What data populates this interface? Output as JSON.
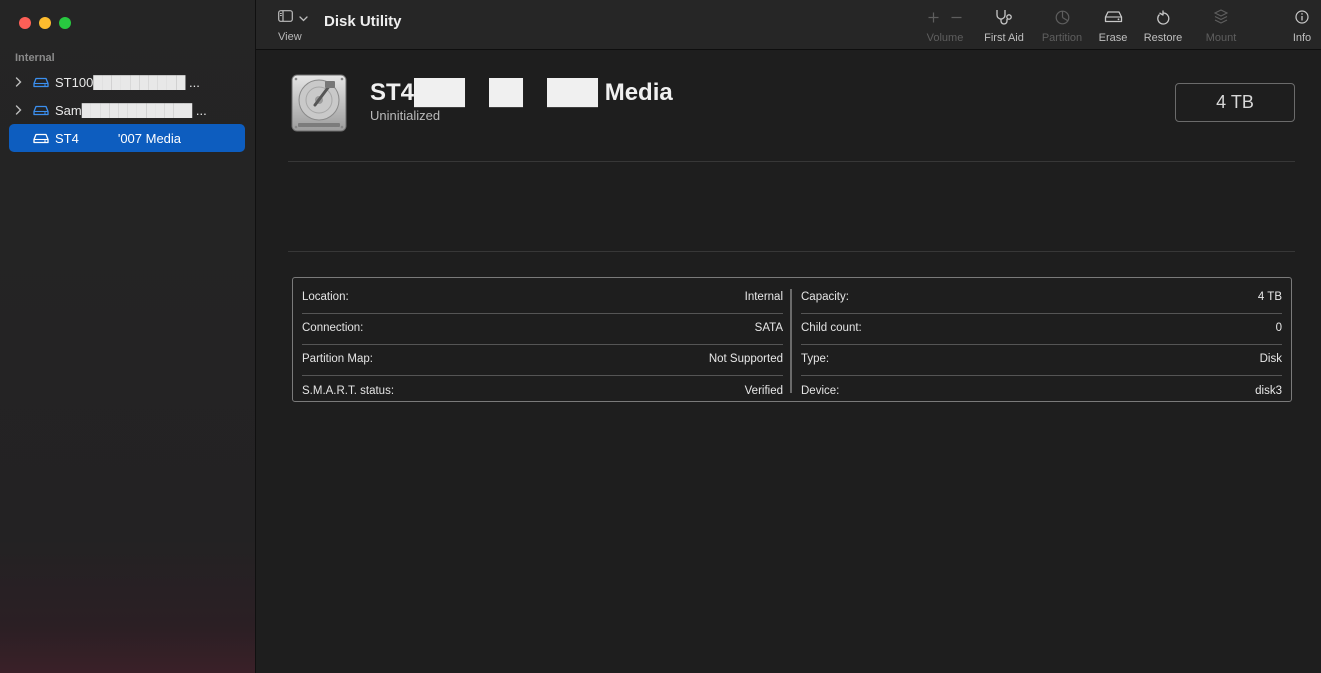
{
  "sidebar": {
    "section_label": "Internal",
    "disks": [
      {
        "name": "ST100██████████ ...",
        "expandable": true,
        "selected": false
      },
      {
        "name": "Sam████████████ ...",
        "expandable": true,
        "selected": false
      },
      {
        "name": "ST4   '007 Media",
        "expandable": false,
        "selected": true
      }
    ]
  },
  "toolbar": {
    "view_label": "View",
    "app_title": "Disk Utility",
    "tools": [
      {
        "label": "Volume",
        "icon": "plus-minus-icon",
        "enabled": false
      },
      {
        "label": "First Aid",
        "icon": "stethoscope-icon",
        "enabled": true
      },
      {
        "label": "Partition",
        "icon": "pie-icon",
        "enabled": false
      },
      {
        "label": "Erase",
        "icon": "erase-car-icon",
        "enabled": true
      },
      {
        "label": "Restore",
        "icon": "restore-arrow-icon",
        "enabled": true
      },
      {
        "label": "Mount",
        "icon": "mount-icon",
        "enabled": false
      },
      {
        "label": "Info",
        "icon": "info-icon",
        "enabled": true
      }
    ]
  },
  "disk": {
    "title": "ST4███ ██ ███ Media",
    "status": "Uninitialized",
    "capacity": "4 TB"
  },
  "info": {
    "left": [
      {
        "label": "Location:",
        "value": "Internal"
      },
      {
        "label": "Connection:",
        "value": "SATA"
      },
      {
        "label": "Partition Map:",
        "value": "Not Supported"
      },
      {
        "label": "S.M.A.R.T. status:",
        "value": "Verified"
      }
    ],
    "right": [
      {
        "label": "Capacity:",
        "value": "4 TB"
      },
      {
        "label": "Child count:",
        "value": "0"
      },
      {
        "label": "Type:",
        "value": "Disk"
      },
      {
        "label": "Device:",
        "value": "disk3"
      }
    ]
  },
  "colors": {
    "accent": "#0d5dbf",
    "close": "#fe5f57",
    "minimize": "#febc2e",
    "zoom": "#28c840"
  }
}
